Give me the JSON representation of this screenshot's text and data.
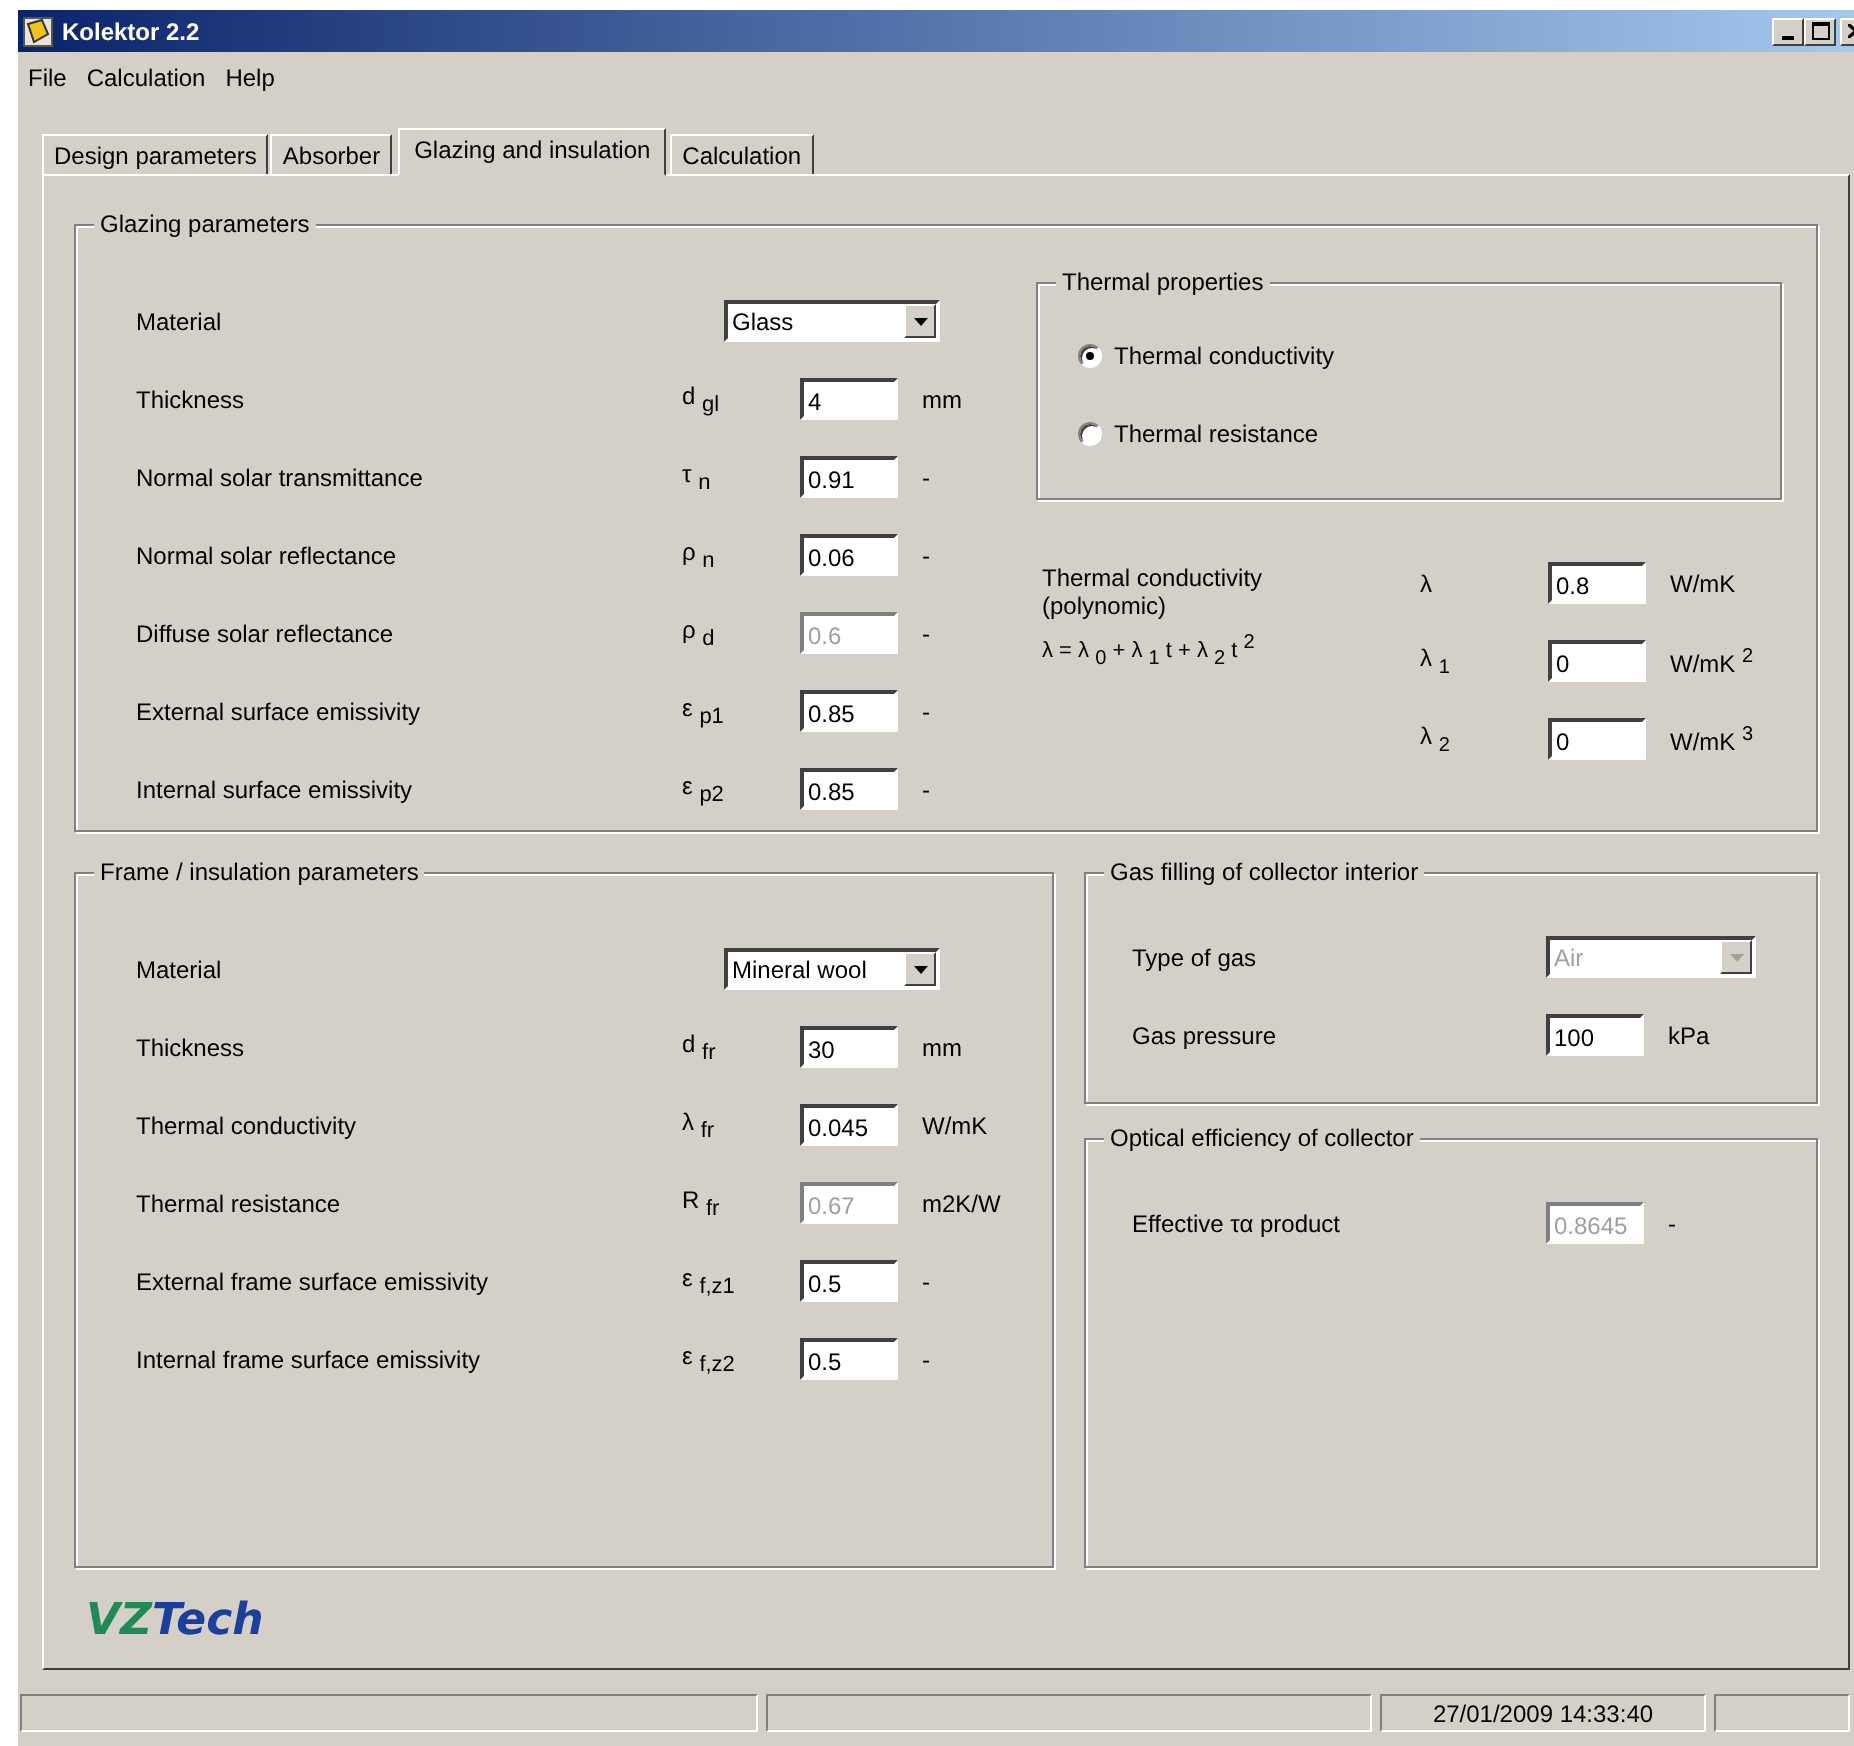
{
  "window": {
    "title": "Kolektor 2.2"
  },
  "menu": [
    "File",
    "Calculation",
    "Help"
  ],
  "tabs": [
    {
      "label": "Design parameters",
      "selected": false
    },
    {
      "label": "Absorber",
      "selected": false
    },
    {
      "label": "Glazing and insulation",
      "selected": true
    },
    {
      "label": "Calculation",
      "selected": false
    }
  ],
  "glazing": {
    "title": "Glazing parameters",
    "rows": [
      {
        "label": "Material",
        "kind": "select",
        "value": "Glass",
        "disabled": false
      },
      {
        "label": "Thickness",
        "kind": "input",
        "symbol": "d $_{gl}$",
        "value": "4",
        "unit": "mm",
        "disabled": false
      },
      {
        "label": "Normal solar transmittance",
        "kind": "input",
        "symbol": "τ $_{n}$",
        "value": "0.91",
        "unit": "-",
        "disabled": false
      },
      {
        "label": "Normal solar reflectance",
        "kind": "input",
        "symbol": "ρ $_{n}$",
        "value": "0.06",
        "unit": "-",
        "disabled": false
      },
      {
        "label": "Diffuse solar reflectance",
        "kind": "input",
        "symbol": "ρ $_{d}$",
        "value": "0.6",
        "unit": "-",
        "disabled": true
      },
      {
        "label": "External surface emissivity",
        "kind": "input",
        "symbol": "ε $_{p1}$",
        "value": "0.85",
        "unit": "-",
        "disabled": false
      },
      {
        "label": "Internal surface emissivity",
        "kind": "input",
        "symbol": "ε $_{p2}$",
        "value": "0.85",
        "unit": "-",
        "disabled": false
      }
    ]
  },
  "thermal_properties": {
    "title": "Thermal properties",
    "options": [
      {
        "label": "Thermal conductivity",
        "selected": true
      },
      {
        "label": "Thermal resistance",
        "selected": false
      }
    ]
  },
  "conductivity": {
    "label": "Thermal conductivity (polynomic)",
    "formula": "λ = λ $_{0}$ + λ $_{1}$ t + λ $_{2}$ t $^{2}$",
    "rows": [
      {
        "symbol": "λ",
        "value": "0.8",
        "unit": "W/mK"
      },
      {
        "symbol": "λ $_{1}$",
        "value": "0",
        "unit": "W/mK $^{2}$"
      },
      {
        "symbol": "λ $_{2}$",
        "value": "0",
        "unit": "W/mK $^{3}$"
      }
    ]
  },
  "frame": {
    "title": "Frame / insulation parameters",
    "rows": [
      {
        "label": "Material",
        "kind": "select",
        "value": "Mineral wool",
        "disabled": false
      },
      {
        "label": "Thickness",
        "kind": "input",
        "symbol": "d $_{fr}$",
        "value": "30",
        "unit": "mm",
        "disabled": false
      },
      {
        "label": "Thermal conductivity",
        "kind": "input",
        "symbol": "λ $_{fr}$",
        "value": "0.045",
        "unit": "W/mK",
        "disabled": false
      },
      {
        "label": "Thermal resistance",
        "kind": "input",
        "symbol": "R $_{fr}$",
        "value": "0.67",
        "unit": "m2K/W",
        "disabled": true
      },
      {
        "label": "External frame surface emissivity",
        "kind": "input",
        "symbol": "ε $_{f,z1}$",
        "value": "0.5",
        "unit": "-",
        "disabled": false
      },
      {
        "label": "Internal frame surface emissivity",
        "kind": "input",
        "symbol": "ε $_{f,z2}$",
        "value": "0.5",
        "unit": "-",
        "disabled": false
      }
    ]
  },
  "gas": {
    "title": "Gas filling of collector interior",
    "rows": [
      {
        "label": "Type of gas",
        "kind": "select",
        "value": "Air",
        "disabled": true
      },
      {
        "label": "Gas pressure",
        "kind": "input",
        "value": "100",
        "unit": "kPa",
        "disabled": false
      }
    ]
  },
  "optical": {
    "title": "Optical efficiency of collector",
    "rows": [
      {
        "label": "Effective τα product",
        "kind": "input",
        "value": "0.8645",
        "unit": "-",
        "disabled": true
      }
    ]
  },
  "logo": {
    "prefix": "VZ",
    "suffix": "Tech"
  },
  "status_bar": {
    "datetime": "27/01/2009 14:33:40"
  }
}
